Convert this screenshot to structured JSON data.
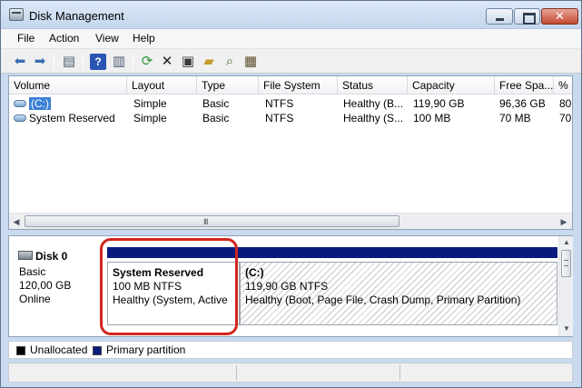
{
  "window": {
    "title": "Disk Management"
  },
  "menu": [
    "File",
    "Action",
    "View",
    "Help"
  ],
  "toolbar": {
    "buttons": [
      "back-arrow",
      "forward-arrow",
      "console-tree",
      "help",
      "properties-pane",
      "refresh",
      "delete",
      "properties",
      "open",
      "search",
      "settings"
    ]
  },
  "volume_table": {
    "headers": [
      "Volume",
      "Layout",
      "Type",
      "File System",
      "Status",
      "Capacity",
      "Free Spa...",
      "%"
    ],
    "rows": [
      {
        "volume": "(C:)",
        "layout": "Simple",
        "type": "Basic",
        "fs": "NTFS",
        "status": "Healthy (B...",
        "capacity": "119,90 GB",
        "free": "96,36 GB",
        "pct": "80"
      },
      {
        "volume": "System Reserved",
        "layout": "Simple",
        "type": "Basic",
        "fs": "NTFS",
        "status": "Healthy (S...",
        "capacity": "100 MB",
        "free": "70 MB",
        "pct": "70"
      }
    ],
    "scroll_grip": "III"
  },
  "disk": {
    "name": "Disk 0",
    "type": "Basic",
    "size": "120,00 GB",
    "state": "Online",
    "partitions": [
      {
        "name": "System Reserved",
        "size_fs": "100 MB NTFS",
        "status": "Healthy (System, Active"
      },
      {
        "name": "(C:)",
        "size_fs": "119,90 GB NTFS",
        "status": "Healthy (Boot, Page File, Crash Dump, Primary Partition)"
      }
    ]
  },
  "legend": {
    "unallocated": "Unallocated",
    "primary": "Primary partition",
    "colors": {
      "unallocated": "#000000",
      "primary": "#0a1a7e"
    }
  },
  "colors": {
    "highlight": "#d3261f",
    "selection": "#3b7fd6"
  }
}
